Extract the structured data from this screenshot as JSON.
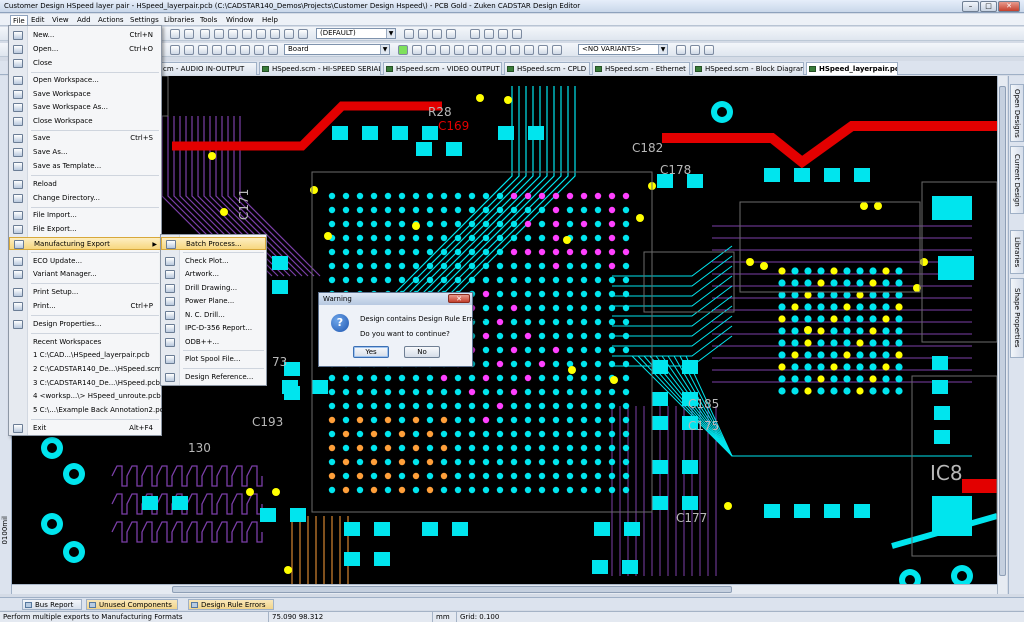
{
  "window": {
    "title": "Customer Design HSpeed layer pair - HSpeed_layerpair.pcb (C:\\CADSTAR140_Demos\\Projects\\Customer Design Hspeed\\) - PCB Gold - Zuken CADSTAR Design Editor"
  },
  "menubar": [
    "File",
    "Edit",
    "View",
    "Add",
    "Actions",
    "Settings",
    "Libraries",
    "Tools",
    "Window",
    "Help"
  ],
  "toolbar": {
    "variant_combo": "(DEFAULT)",
    "layer_combo": "Board",
    "variants_combo": "<NO VARIANTS>"
  },
  "doc_tabs": [
    "cm - AUDIO IN-OUTPUT",
    "HSpeed.scm - HI-SPEED SERIAL",
    "HSpeed.scm - VIDEO OUTPUT",
    "HSpeed.scm - CPLD",
    "HSpeed.scm - Ethernet",
    "HSpeed.scm - Block Diagram",
    "HSpeed_layerpair.pcb"
  ],
  "file_menu": [
    {
      "label": "New...",
      "shortcut": "Ctrl+N"
    },
    {
      "label": "Open...",
      "shortcut": "Ctrl+O"
    },
    {
      "label": "Close",
      "shortcut": ""
    },
    {
      "label": "Open Workspace...",
      "shortcut": ""
    },
    {
      "label": "Save Workspace",
      "shortcut": ""
    },
    {
      "label": "Save Workspace As...",
      "shortcut": ""
    },
    {
      "label": "Close Workspace",
      "shortcut": ""
    },
    {
      "label": "Save",
      "shortcut": "Ctrl+S"
    },
    {
      "label": "Save As...",
      "shortcut": ""
    },
    {
      "label": "Save as Template...",
      "shortcut": ""
    },
    {
      "label": "Reload",
      "shortcut": ""
    },
    {
      "label": "Change Directory...",
      "shortcut": ""
    },
    {
      "label": "File Import...",
      "shortcut": ""
    },
    {
      "label": "File Export...",
      "shortcut": ""
    },
    {
      "label": "Manufacturing Export",
      "shortcut": ""
    },
    {
      "label": "ECO Update...",
      "shortcut": ""
    },
    {
      "label": "Variant Manager...",
      "shortcut": ""
    },
    {
      "label": "Print Setup...",
      "shortcut": ""
    },
    {
      "label": "Print...",
      "shortcut": "Ctrl+P"
    },
    {
      "label": "Design Properties...",
      "shortcut": ""
    },
    {
      "label": "Recent Workspaces",
      "shortcut": ""
    },
    {
      "label": "1 C:\\CAD...\\HSpeed_layerpair.pcb",
      "shortcut": ""
    },
    {
      "label": "2 C:\\CADSTAR140_De...\\HSpeed.scm",
      "shortcut": ""
    },
    {
      "label": "3 C:\\CADSTAR140_De...\\HSpeed.pcb",
      "shortcut": ""
    },
    {
      "label": "4 <worksp...\\> HSpeed_unroute.pcb",
      "shortcut": ""
    },
    {
      "label": "5 C:\\...\\Example Back Annotation2.pcb",
      "shortcut": ""
    },
    {
      "label": "Exit",
      "shortcut": "Alt+F4"
    }
  ],
  "mfg_submenu": [
    "Batch Process...",
    "Check Plot...",
    "Artwork...",
    "Drill Drawing...",
    "Power Plane...",
    "N. C. Drill...",
    "IPC-D-356 Report...",
    "ODB++...",
    "Plot Spool File...",
    "Design Reference..."
  ],
  "dialog": {
    "title": "Warning",
    "message1": "Design contains Design Rule Errors.",
    "message2": "Do you want to continue?",
    "yes": "Yes",
    "no": "No"
  },
  "pcb_labels": [
    "R28",
    "C169",
    "C182",
    "C178",
    "C171",
    "C193",
    "C185",
    "C175",
    "C177",
    "IC8",
    "130",
    "73"
  ],
  "side_tabs": [
    "Open Designs",
    "Current Design",
    "Libraries",
    "Shape Properties"
  ],
  "left_tab": "0100mil",
  "bottom_tabs": [
    "Bus Report",
    "Unused Components",
    "Design Rule Errors"
  ],
  "status": {
    "message": "Perform multiple exports to Manufacturing Formats",
    "coords": "75.090  98.312",
    "units": "mm",
    "grid": "Grid: 0.100"
  },
  "colors": {
    "board_bg": "#000000",
    "pad": "#00e5ee",
    "trace_top": "#e30000",
    "via_yellow": "#ffff00",
    "via_orange": "#ff9f3a",
    "via_magenta": "#ff40ff",
    "trace_purple": "#7b3fa8"
  }
}
